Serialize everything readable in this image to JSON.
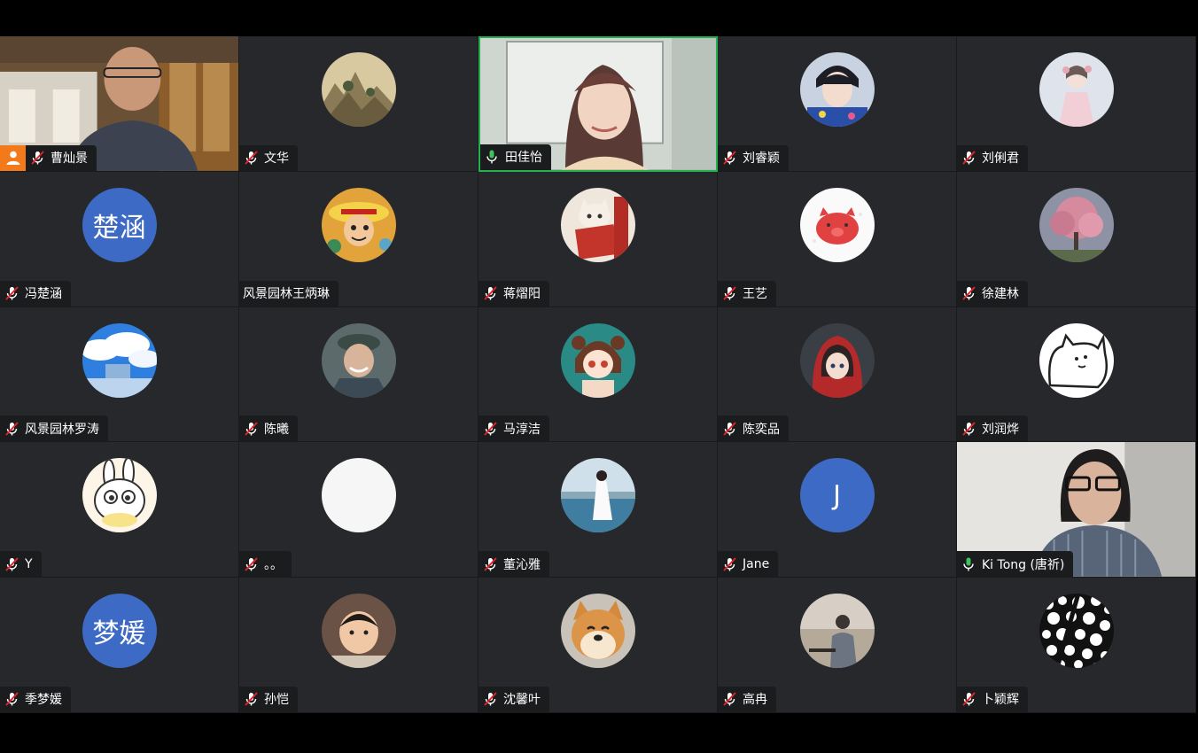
{
  "participants": [
    {
      "name": "曹灿景",
      "mic": "muted",
      "kind": "video",
      "style": "room-man",
      "host": true
    },
    {
      "name": "文华",
      "mic": "muted",
      "kind": "avatar",
      "avatar": "landscape-painting"
    },
    {
      "name": "田佳怡",
      "mic": "on",
      "kind": "video",
      "style": "girl-whiteboard",
      "speaking": true
    },
    {
      "name": "刘睿颖",
      "mic": "muted",
      "kind": "avatar",
      "avatar": "boy-portrait"
    },
    {
      "name": "刘俐君",
      "mic": "muted",
      "kind": "avatar",
      "avatar": "girl-hanfu"
    },
    {
      "name": "冯楚涵",
      "mic": "muted",
      "kind": "initials",
      "initials": "楚涵"
    },
    {
      "name": "风景园林王炳琳",
      "mic": "none",
      "kind": "avatar",
      "avatar": "luffy"
    },
    {
      "name": "蒋熠阳",
      "mic": "muted",
      "kind": "avatar",
      "avatar": "cat-book"
    },
    {
      "name": "王艺",
      "mic": "muted",
      "kind": "avatar",
      "avatar": "red-pig"
    },
    {
      "name": "徐建林",
      "mic": "muted",
      "kind": "avatar",
      "avatar": "pink-tree"
    },
    {
      "name": "风景园林罗涛",
      "mic": "muted",
      "kind": "avatar",
      "avatar": "sky-clouds"
    },
    {
      "name": "陈曦",
      "mic": "muted",
      "kind": "avatar",
      "avatar": "old-man"
    },
    {
      "name": "马淳洁",
      "mic": "muted",
      "kind": "avatar",
      "avatar": "chibi-girl"
    },
    {
      "name": "陈奕品",
      "mic": "muted",
      "kind": "avatar",
      "avatar": "anime-red-hood"
    },
    {
      "name": "刘润烨",
      "mic": "muted",
      "kind": "avatar",
      "avatar": "white-cat-drawing"
    },
    {
      "name": "Y",
      "mic": "muted",
      "kind": "avatar",
      "avatar": "bunny-cartoon"
    },
    {
      "name": "。。",
      "mic": "muted",
      "kind": "avatar",
      "avatar": "blank-white"
    },
    {
      "name": "董沁雅",
      "mic": "muted",
      "kind": "avatar",
      "avatar": "seaside-girl"
    },
    {
      "name": "Jane",
      "mic": "muted",
      "kind": "initials",
      "initials": "J"
    },
    {
      "name": "Ki Tong (唐祈)",
      "mic": "on",
      "kind": "video",
      "style": "woman-glasses"
    },
    {
      "name": "季梦媛",
      "mic": "muted",
      "kind": "initials",
      "initials": "梦媛"
    },
    {
      "name": "孙恺",
      "mic": "muted",
      "kind": "avatar",
      "avatar": "child-photo"
    },
    {
      "name": "沈馨叶",
      "mic": "muted",
      "kind": "avatar",
      "avatar": "shiba-dog"
    },
    {
      "name": "高冉",
      "mic": "muted",
      "kind": "avatar",
      "avatar": "man-outdoor"
    },
    {
      "name": "卜颖辉",
      "mic": "muted",
      "kind": "avatar",
      "avatar": "bubble-pattern"
    }
  ]
}
